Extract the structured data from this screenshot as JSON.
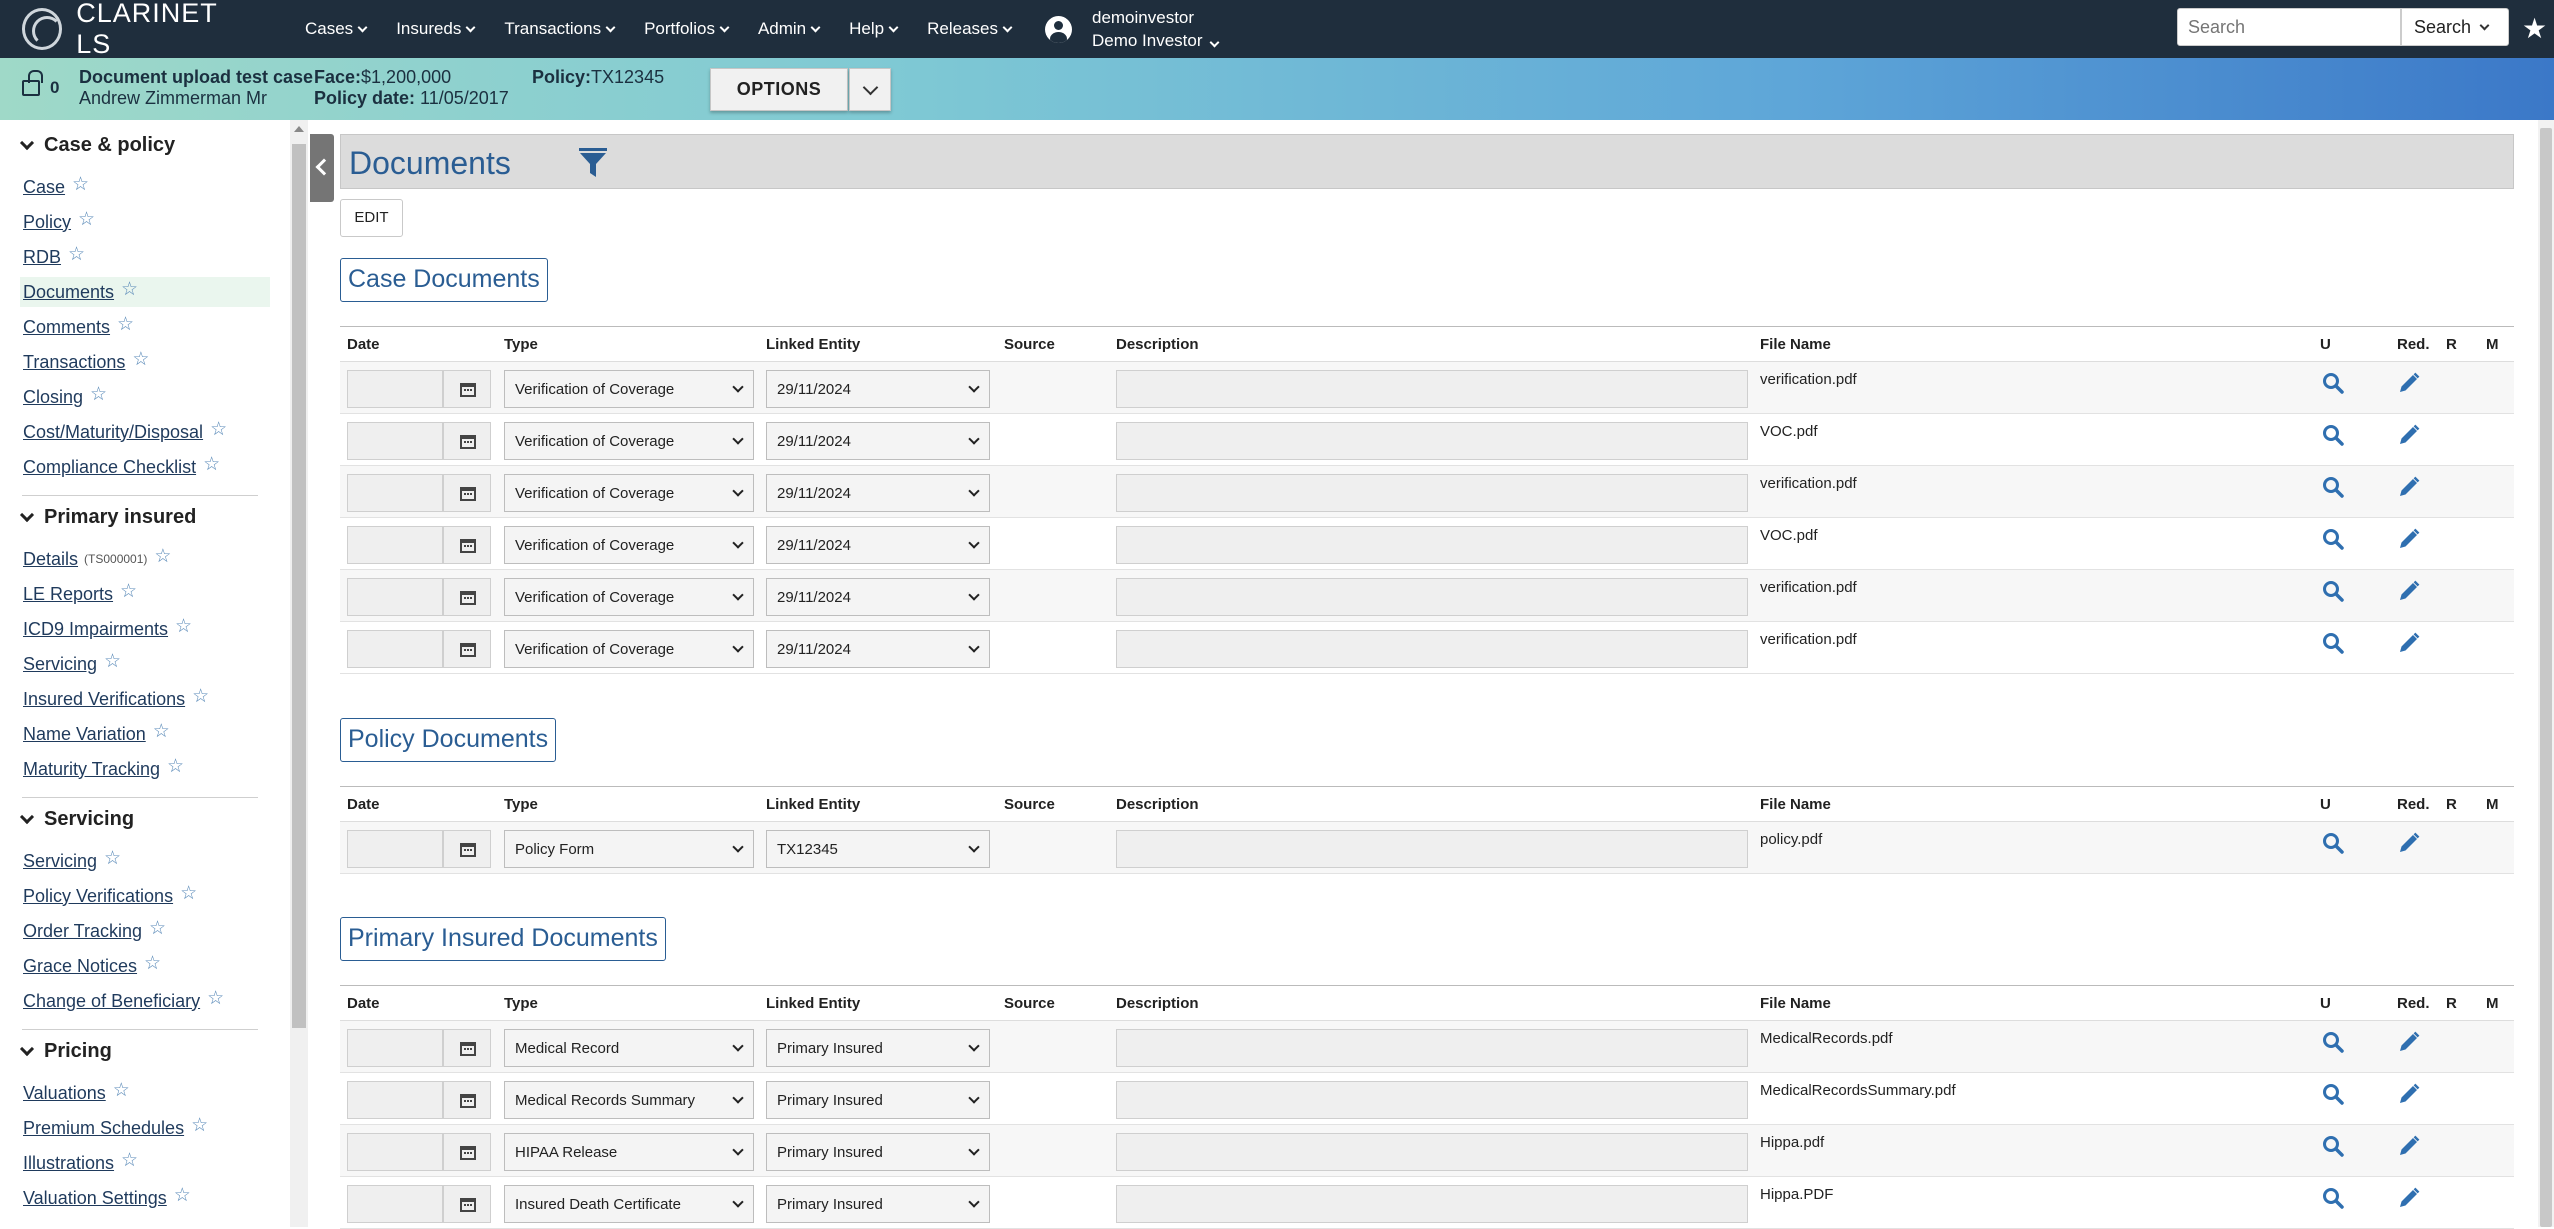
{
  "app": {
    "name": "CLARINET LS"
  },
  "nav": {
    "menus": [
      "Cases",
      "Insureds",
      "Transactions",
      "Portfolios",
      "Admin",
      "Help",
      "Releases"
    ],
    "user": {
      "login": "demoinvestor",
      "name": "Demo Investor"
    },
    "search": {
      "placeholder": "Search",
      "button": "Search"
    }
  },
  "context": {
    "lock_count": "0",
    "case_title": "Document upload test case",
    "insured": "Andrew Zimmerman Mr",
    "face_label": "Face:",
    "face_value": "$1,200,000",
    "policy_date_label": "Policy date:",
    "policy_date_value": "11/05/2017",
    "policy_label": "Policy:",
    "policy_value": "TX12345",
    "options_label": "OPTIONS"
  },
  "sidebar": {
    "sections": [
      {
        "title": "Case & policy",
        "items": [
          {
            "label": "Case"
          },
          {
            "label": "Policy"
          },
          {
            "label": "RDB"
          },
          {
            "label": "Documents",
            "active": true
          },
          {
            "label": "Comments"
          },
          {
            "label": "Transactions"
          },
          {
            "label": "Closing"
          },
          {
            "label": "Cost/Maturity/Disposal"
          },
          {
            "label": "Compliance Checklist"
          }
        ]
      },
      {
        "title": "Primary insured",
        "items": [
          {
            "label": "Details",
            "sub": "(TS000001)"
          },
          {
            "label": "LE Reports"
          },
          {
            "label": "ICD9 Impairments"
          },
          {
            "label": "Servicing"
          },
          {
            "label": "Insured Verifications"
          },
          {
            "label": "Name Variation"
          },
          {
            "label": "Maturity Tracking"
          }
        ]
      },
      {
        "title": "Servicing",
        "items": [
          {
            "label": "Servicing"
          },
          {
            "label": "Policy Verifications"
          },
          {
            "label": "Order Tracking"
          },
          {
            "label": "Grace Notices"
          },
          {
            "label": "Change of Beneficiary"
          }
        ]
      },
      {
        "title": "Pricing",
        "items": [
          {
            "label": "Valuations"
          },
          {
            "label": "Premium Schedules"
          },
          {
            "label": "Illustrations"
          },
          {
            "label": "Valuation Settings"
          }
        ]
      }
    ]
  },
  "page": {
    "title": "Documents",
    "edit_label": "EDIT"
  },
  "columns": [
    "Date",
    "Type",
    "Linked Entity",
    "Source",
    "Description",
    "File Name",
    "U",
    "Red.",
    "R",
    "M"
  ],
  "sections": [
    {
      "title": "Case Documents",
      "rows": [
        {
          "type": "Verification of Coverage",
          "linked": "29/11/2024",
          "file": "verification.pdf"
        },
        {
          "type": "Verification of Coverage",
          "linked": "29/11/2024",
          "file": "VOC.pdf"
        },
        {
          "type": "Verification of Coverage",
          "linked": "29/11/2024",
          "file": "verification.pdf"
        },
        {
          "type": "Verification of Coverage",
          "linked": "29/11/2024",
          "file": "VOC.pdf"
        },
        {
          "type": "Verification of Coverage",
          "linked": "29/11/2024",
          "file": "verification.pdf"
        },
        {
          "type": "Verification of Coverage",
          "linked": "29/11/2024",
          "file": "verification.pdf"
        }
      ]
    },
    {
      "title": "Policy Documents",
      "rows": [
        {
          "type": "Policy Form",
          "linked": "TX12345",
          "file": "policy.pdf"
        }
      ]
    },
    {
      "title": "Primary Insured Documents",
      "rows": [
        {
          "type": "Medical Record",
          "linked": "Primary Insured",
          "file": "MedicalRecords.pdf"
        },
        {
          "type": "Medical Records Summary",
          "linked": "Primary Insured",
          "file": "MedicalRecordsSummary.pdf"
        },
        {
          "type": "HIPAA Release",
          "linked": "Primary Insured",
          "file": "Hippa.pdf"
        },
        {
          "type": "Insured Death Certificate",
          "linked": "Primary Insured",
          "file": "Hippa.PDF"
        }
      ]
    }
  ],
  "icons": {
    "view": "magnifier-icon",
    "redact": "pencil-icon",
    "calendar": "calendar-icon",
    "filter": "filter-icon",
    "favorite": "star-icon",
    "lock": "lock-icon",
    "user": "user-icon"
  },
  "colors": {
    "nav_bg": "#1f2e3d",
    "accent": "#2a5d93",
    "icon_blue": "#2f6fb0"
  }
}
